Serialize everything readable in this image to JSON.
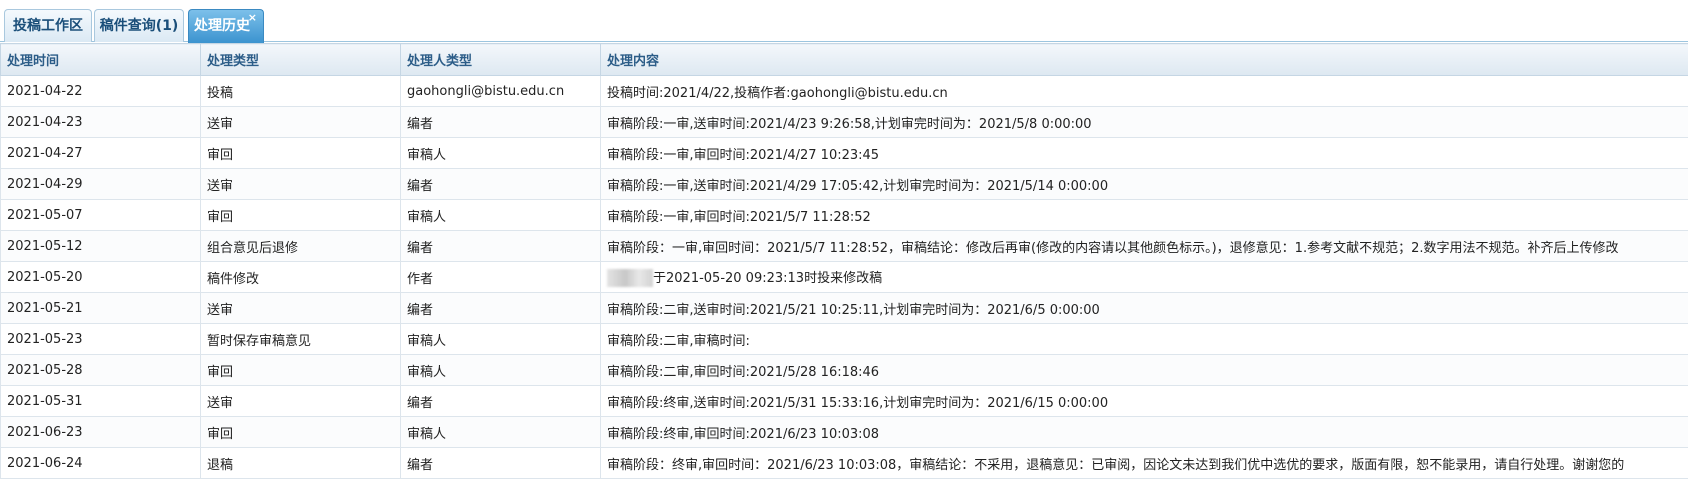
{
  "tabs": [
    {
      "label": "投稿工作区",
      "active": false
    },
    {
      "label": "稿件查询(1)",
      "active": false
    },
    {
      "label": "处理历史",
      "active": true
    }
  ],
  "tab_close_symbol": "×",
  "table": {
    "columns": [
      "处理时间",
      "处理类型",
      "处理人类型",
      "处理内容"
    ],
    "rows": [
      [
        "2021-04-22",
        "投稿",
        "gaohongli@bistu.edu.cn",
        "投稿时间:2021/4/22,投稿作者:gaohongli@bistu.edu.cn"
      ],
      [
        "2021-04-23",
        "送审",
        "编者",
        "审稿阶段:一审,送审时间:2021/4/23 9:26:58,计划审完时间为：2021/5/8 0:00:00"
      ],
      [
        "2021-04-27",
        "审回",
        "审稿人",
        "审稿阶段:一审,审回时间:2021/4/27 10:23:45"
      ],
      [
        "2021-04-29",
        "送审",
        "编者",
        "审稿阶段:一审,送审时间:2021/4/29 17:05:42,计划审完时间为：2021/5/14 0:00:00"
      ],
      [
        "2021-05-07",
        "审回",
        "审稿人",
        "审稿阶段:一审,审回时间:2021/5/7 11:28:52"
      ],
      [
        "2021-05-12",
        "组合意见后退修",
        "编者",
        "审稿阶段：一审,审回时间：2021/5/7 11:28:52，审稿结论：修改后再审(修改的内容请以其他颜色标示。)，退修意见：1.参考文献不规范；2.数字用法不规范。补齐后上传修改"
      ],
      [
        "2021-05-20",
        "稿件修改",
        "作者",
        "于2021-05-20 09:23:13时投来修改稿"
      ],
      [
        "2021-05-21",
        "送审",
        "编者",
        "审稿阶段:二审,送审时间:2021/5/21 10:25:11,计划审完时间为：2021/6/5 0:00:00"
      ],
      [
        "2021-05-23",
        "暂时保存审稿意见",
        "审稿人",
        "审稿阶段:二审,审稿时间:"
      ],
      [
        "2021-05-28",
        "审回",
        "审稿人",
        "审稿阶段:二审,审回时间:2021/5/28 16:18:46"
      ],
      [
        "2021-05-31",
        "送审",
        "编者",
        "审稿阶段:终审,送审时间:2021/5/31 15:33:16,计划审完时间为：2021/6/15 0:00:00"
      ],
      [
        "2021-06-23",
        "审回",
        "审稿人",
        "审稿阶段:终审,审回时间:2021/6/23 10:03:08"
      ],
      [
        "2021-06-24",
        "退稿",
        "编者",
        "审稿阶段：终审,审回时间：2021/6/23 10:03:08，审稿结论：不采用，退稿意见：已审阅，因论文未达到我们优中选优的要求，版面有限，恕不能录用，请自行处理。谢谢您的"
      ]
    ]
  },
  "redacted_row_index": 6,
  "colors": {
    "accent": "#3b93cf",
    "header_text": "#2c5d88",
    "border": "#dde5ec"
  }
}
